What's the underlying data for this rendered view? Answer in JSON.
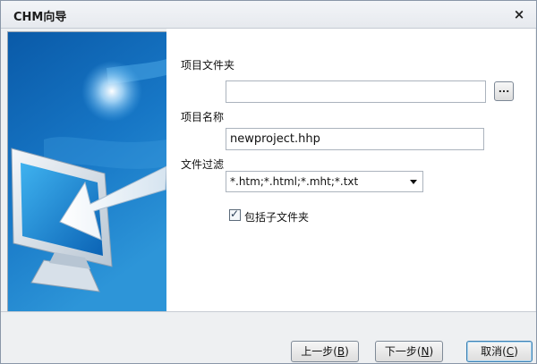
{
  "window": {
    "title": "CHM向导",
    "close_glyph": "×"
  },
  "form": {
    "project_folder_label": "项目文件夹",
    "project_folder_value": "",
    "browse_label": "...",
    "project_name_label": "项目名称",
    "project_name_value": "newproject.hhp",
    "file_filter_label": "文件过滤",
    "file_filter_value": "*.htm;*.html;*.mht;*.txt",
    "include_subfolders_label": "包括子文件夹",
    "include_subfolders_checked": true,
    "check_glyph": "✓"
  },
  "buttons": {
    "back_label": "上一步(",
    "back_key": "B",
    "back_close": ")",
    "next_label": "下一步(",
    "next_key": "N",
    "next_close": ")",
    "cancel_label": "取消(",
    "cancel_key": "C",
    "cancel_close": ")"
  },
  "icons": {
    "sidebar_art": "monitor-with-arrow-icon",
    "dropdown": "chevron-down-icon",
    "close": "close-icon"
  },
  "colors": {
    "sidebar_top": "#0a63b8",
    "sidebar_bottom": "#2d8fd4",
    "default_button_border": "#3c7fb1"
  }
}
